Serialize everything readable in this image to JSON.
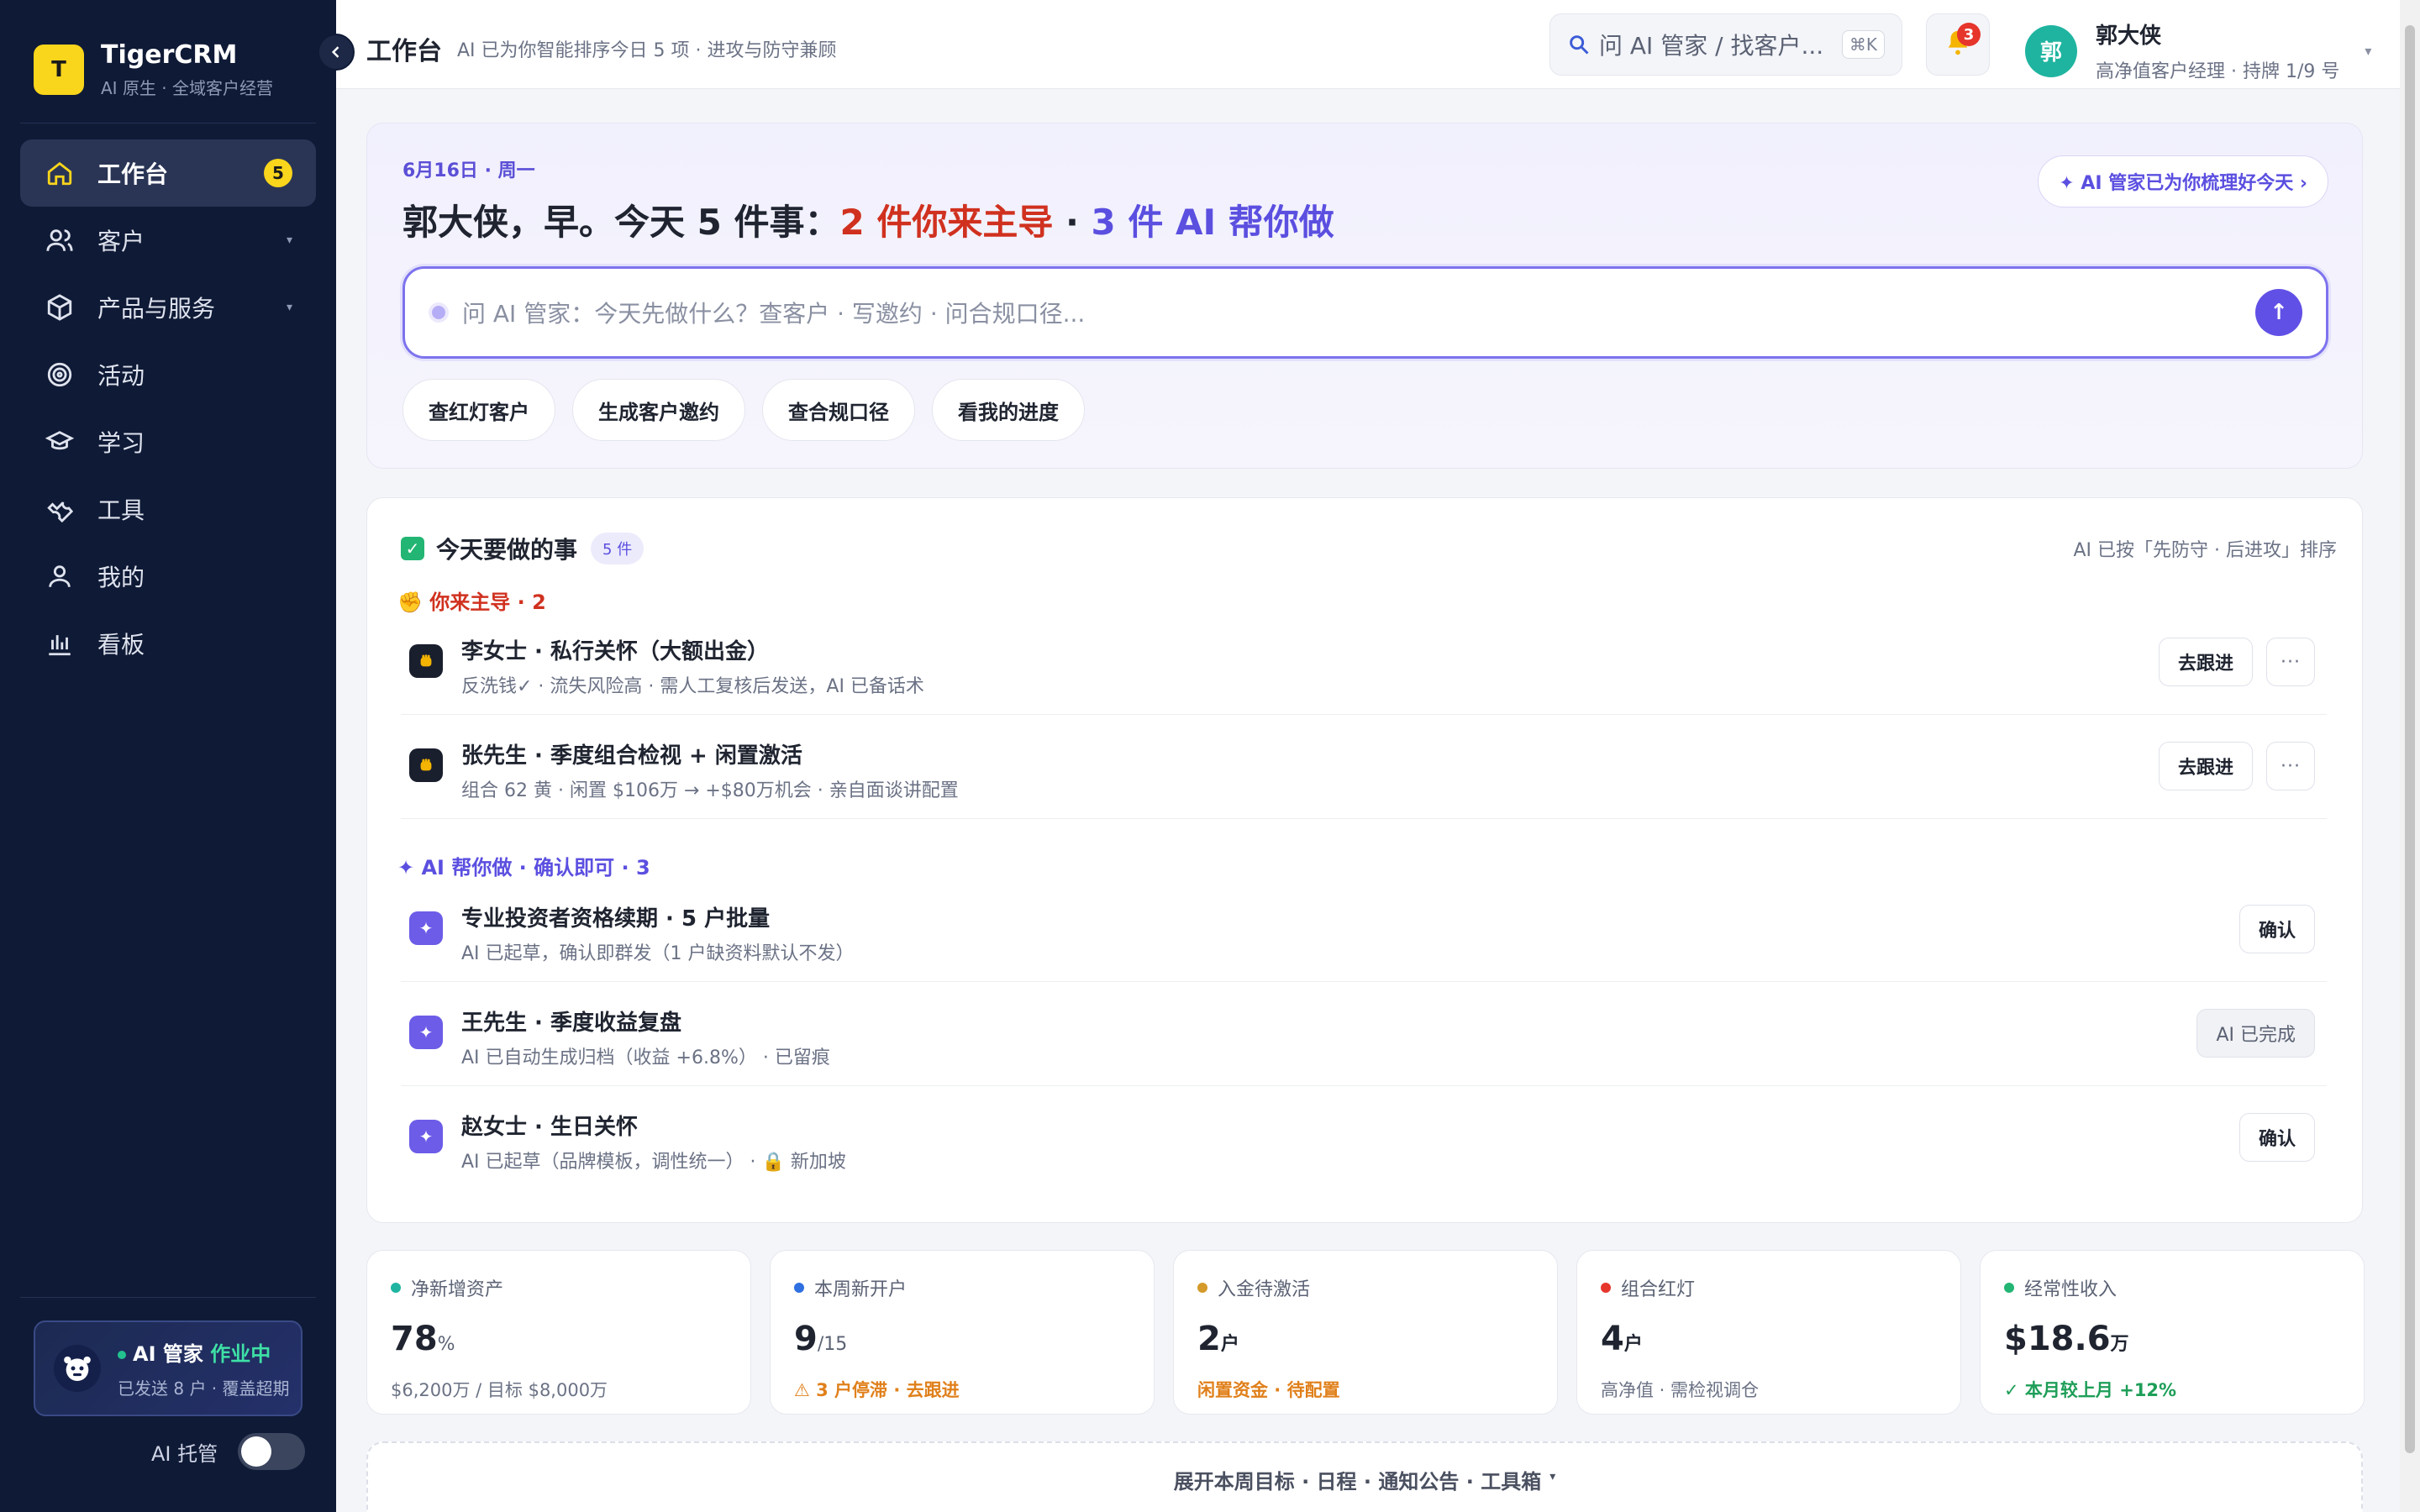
{
  "brand": {
    "logo_letter": "T",
    "name": "TigerCRM",
    "tagline": "AI 原生 · 全域客户经营"
  },
  "sidebar": {
    "collapse_icon": "chevron-left-icon",
    "items": [
      {
        "label": "工作台",
        "icon": "home-icon",
        "active": true,
        "badge": "5"
      },
      {
        "label": "客户",
        "icon": "users-icon",
        "caret": "▾"
      },
      {
        "label": "产品与服务",
        "icon": "box-icon",
        "caret": "▾"
      },
      {
        "label": "活动",
        "icon": "target-icon"
      },
      {
        "label": "学习",
        "icon": "graduation-cap-icon"
      },
      {
        "label": "工具",
        "icon": "wrench-icon"
      },
      {
        "label": "我的",
        "icon": "user-icon"
      },
      {
        "label": "看板",
        "icon": "bar-chart-icon"
      }
    ],
    "ai_card": {
      "title": "AI 管家",
      "status": "作业中",
      "sub": "已发送 8 户 · 覆盖超期"
    },
    "ai_hosting": {
      "label": "AI 托管",
      "on": false
    }
  },
  "topbar": {
    "title": "工作台",
    "subtitle": "AI 已为你智能排序今日 5 项 · 进攻与防守兼顾",
    "search_text": "问 AI 管家 / 找客户...",
    "search_shortcut": "⌘K",
    "bell_count": "3",
    "user": {
      "avatar": "郭",
      "name": "郭大侠",
      "role": "高净值客户经理 · 持牌 1/9 号",
      "caret": "▾"
    }
  },
  "hero": {
    "date": "6月16日 · 周一",
    "headline_prefix": "郭大侠，早。今天 5 件事：",
    "headline_red": "2 件你来主导",
    "headline_sep": " · ",
    "headline_purple": "3 件 AI 帮你做",
    "pill": "✦ AI 管家已为你梳理好今天 ›",
    "ask_placeholder": "问 AI 管家：今天先做什么？查客户 · 写邀约 · 问合规口径...",
    "send_icon": "↑",
    "chips": [
      "查红灯客户",
      "生成客户邀约",
      "查合规口径",
      "看我的进度"
    ]
  },
  "today": {
    "title": "今天要做的事",
    "count": "5 件",
    "sort_note": "AI 已按「先防守 · 后进攻」排序",
    "lead_group": "✊ 你来主导 · 2",
    "ai_group": "✦ AI 帮你做 · 确认即可 · 3",
    "tasks": [
      {
        "title": "李女士 · 私行关怀（大额出金）",
        "desc": "反洗钱✓ · 流失风险高 · 需人工复核后发送，AI 已备话术",
        "action": "去跟进",
        "icon": "fist-icon"
      },
      {
        "title": "张先生 · 季度组合检视 + 闲置激活",
        "desc": "组合 62 黄 · 闲置 $106万 → +$80万机会 · 亲自面谈讲配置",
        "action": "去跟进",
        "icon": "fist-icon"
      },
      {
        "title": "专业投资者资格续期 · 5 户批量",
        "desc": "AI 已起草，确认即群发（1 户缺资料默认不发）",
        "action": "确认",
        "icon": "sparkle-icon"
      },
      {
        "title": "王先生 · 季度收益复盘",
        "desc": "AI 已自动生成归档（收益 +6.8%） · 已留痕",
        "action": "AI 已完成",
        "icon": "sparkle-icon"
      },
      {
        "title": "赵女士 · 生日关怀",
        "desc": "AI 已起草（品牌模板，调性统一） · 🔒 新加坡",
        "action": "确认",
        "icon": "sparkle-icon"
      }
    ],
    "more_icon": "···"
  },
  "stats": [
    {
      "label": "净新增资产",
      "color": "#1fb4a0",
      "value": "78",
      "unit": "%",
      "foot": "$6,200万 / 目标 $8,000万",
      "foot_style": ""
    },
    {
      "label": "本周新开户",
      "color": "#2f6fe0",
      "value": "9",
      "unit": "/15",
      "foot": "⚠ 3 户停滞 · 去跟进",
      "foot_style": "warn"
    },
    {
      "label": "入金待激活",
      "color": "#d49a2a",
      "value": "2",
      "unit": "户",
      "foot": "闲置资金 · 待配置",
      "foot_style": "warn"
    },
    {
      "label": "组合红灯",
      "color": "#e6352b",
      "value": "4",
      "unit": "户",
      "foot": "高净值 · 需检视调仓",
      "foot_style": ""
    },
    {
      "label": "经常性收入",
      "color": "#22b573",
      "value": "$18.6",
      "unit": "万",
      "foot": "✓ 本月较上月 +12%",
      "foot_style": "good"
    }
  ],
  "expand": {
    "label": "展开本周目标 · 日程 · 通知公告 · 工具箱",
    "caret": "▾"
  }
}
